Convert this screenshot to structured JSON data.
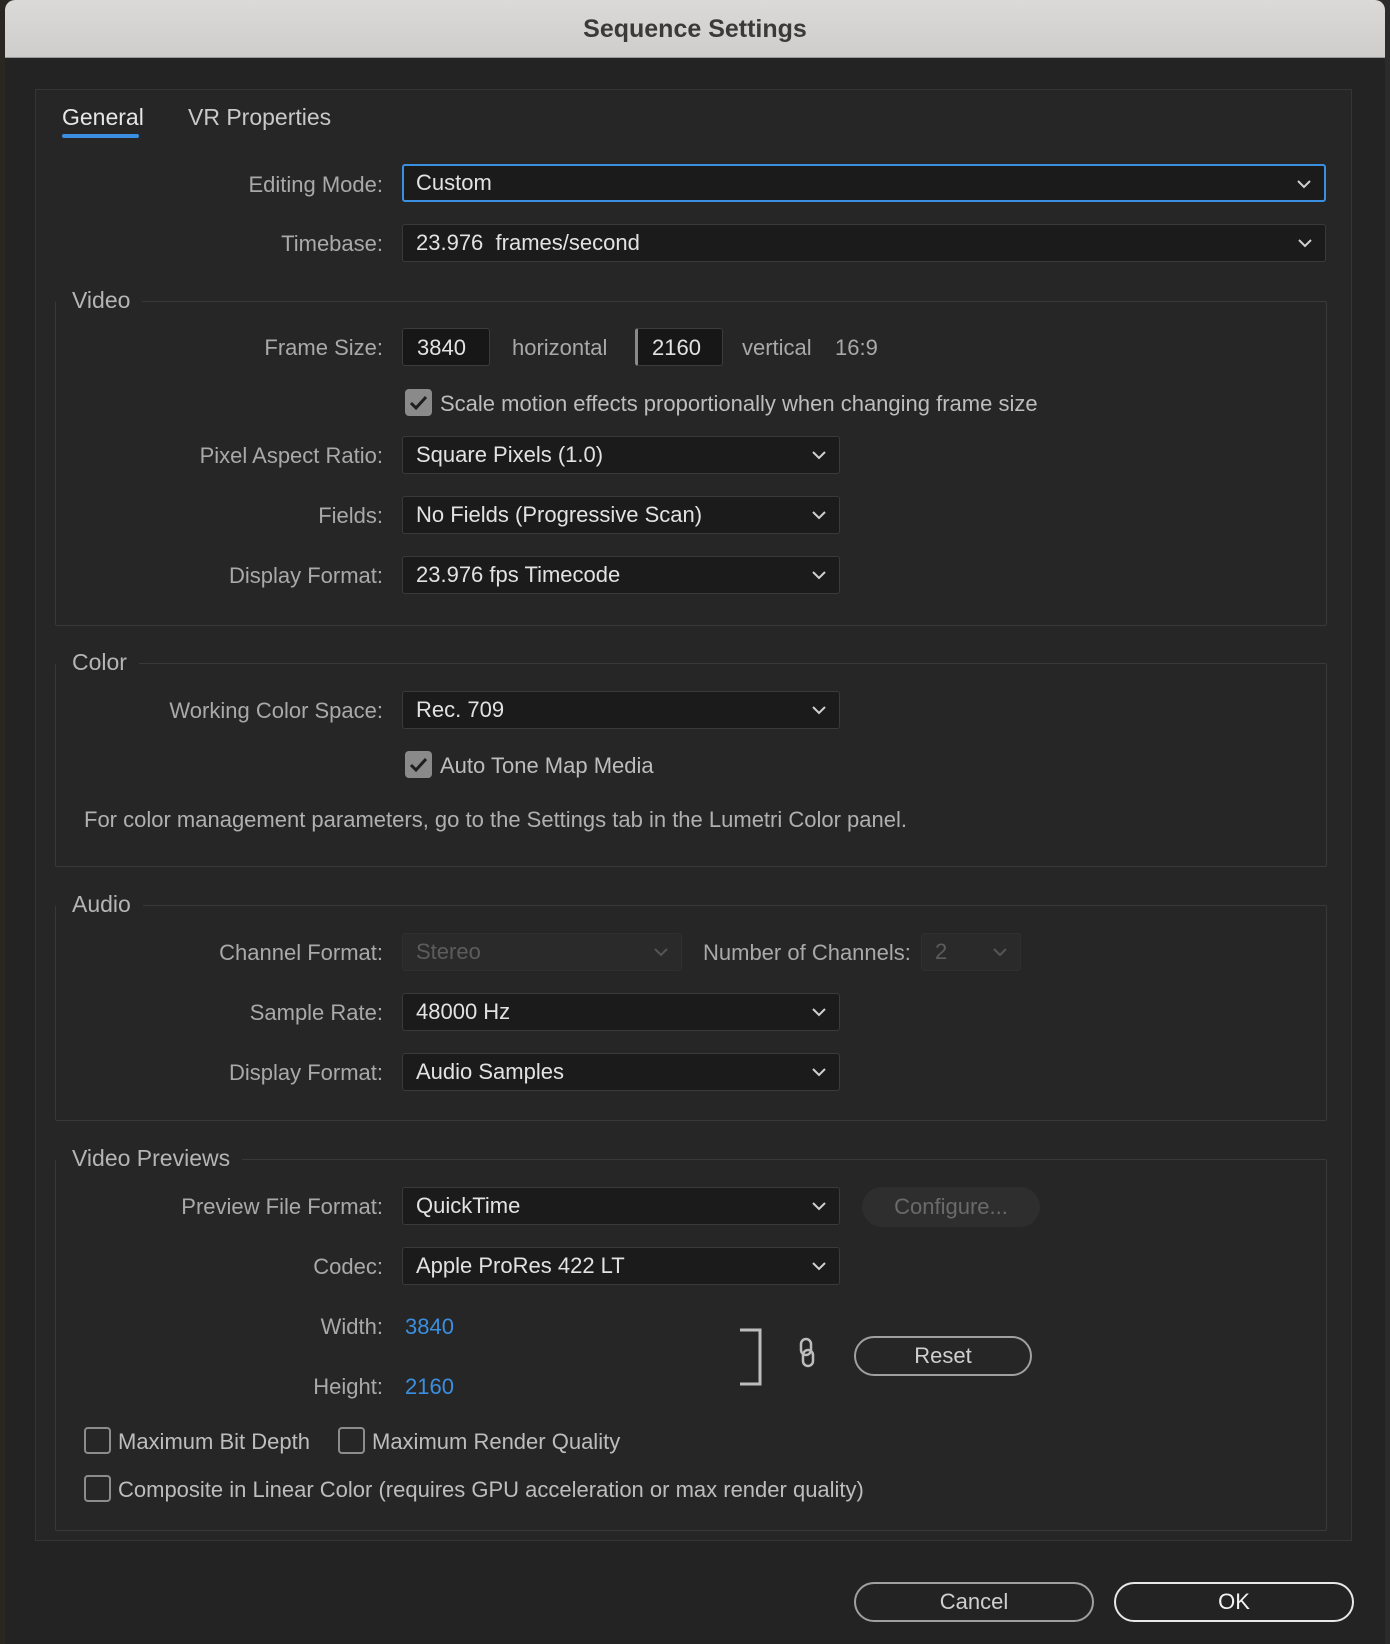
{
  "window": {
    "title": "Sequence Settings"
  },
  "tabs": [
    {
      "label": "General"
    },
    {
      "label": "VR Properties"
    }
  ],
  "general": {
    "editing_mode_label": "Editing Mode:",
    "editing_mode_value": "Custom",
    "timebase_label": "Timebase:",
    "timebase_value": "23.976  frames/second"
  },
  "video": {
    "title": "Video",
    "frame_size_label": "Frame Size:",
    "frame_width": "3840",
    "horizontal_label": "horizontal",
    "frame_height": "2160",
    "vertical_label": "vertical",
    "aspect": "16:9",
    "scale_motion_label": "Scale motion effects proportionally when changing frame size",
    "scale_motion_checked": true,
    "pixel_aspect_label": "Pixel Aspect Ratio:",
    "pixel_aspect_value": "Square Pixels (1.0)",
    "fields_label": "Fields:",
    "fields_value": "No Fields (Progressive Scan)",
    "display_format_label": "Display Format:",
    "display_format_value": "23.976 fps Timecode"
  },
  "color": {
    "title": "Color",
    "working_space_label": "Working Color Space:",
    "working_space_value": "Rec. 709",
    "auto_tone_label": "Auto Tone Map Media",
    "auto_tone_checked": true,
    "note": "For color management parameters, go to the Settings tab in the Lumetri Color panel."
  },
  "audio": {
    "title": "Audio",
    "channel_format_label": "Channel Format:",
    "channel_format_value": "Stereo",
    "num_channels_label": "Number of Channels:",
    "num_channels_value": "2",
    "sample_rate_label": "Sample Rate:",
    "sample_rate_value": "48000 Hz",
    "display_format_label": "Display Format:",
    "display_format_value": "Audio Samples"
  },
  "previews": {
    "title": "Video Previews",
    "file_format_label": "Preview File Format:",
    "file_format_value": "QuickTime",
    "configure_label": "Configure...",
    "codec_label": "Codec:",
    "codec_value": "Apple ProRes 422 LT",
    "width_label": "Width:",
    "width_value": "3840",
    "height_label": "Height:",
    "height_value": "2160",
    "reset_label": "Reset",
    "max_bit_depth_label": "Maximum Bit Depth",
    "max_render_quality_label": "Maximum Render Quality",
    "composite_linear_label": "Composite in Linear Color (requires GPU acceleration or max render quality)"
  },
  "footer": {
    "cancel_label": "Cancel",
    "ok_label": "OK"
  },
  "colors": {
    "accent": "#3b8fe0",
    "dialog_bg": "#232323"
  }
}
